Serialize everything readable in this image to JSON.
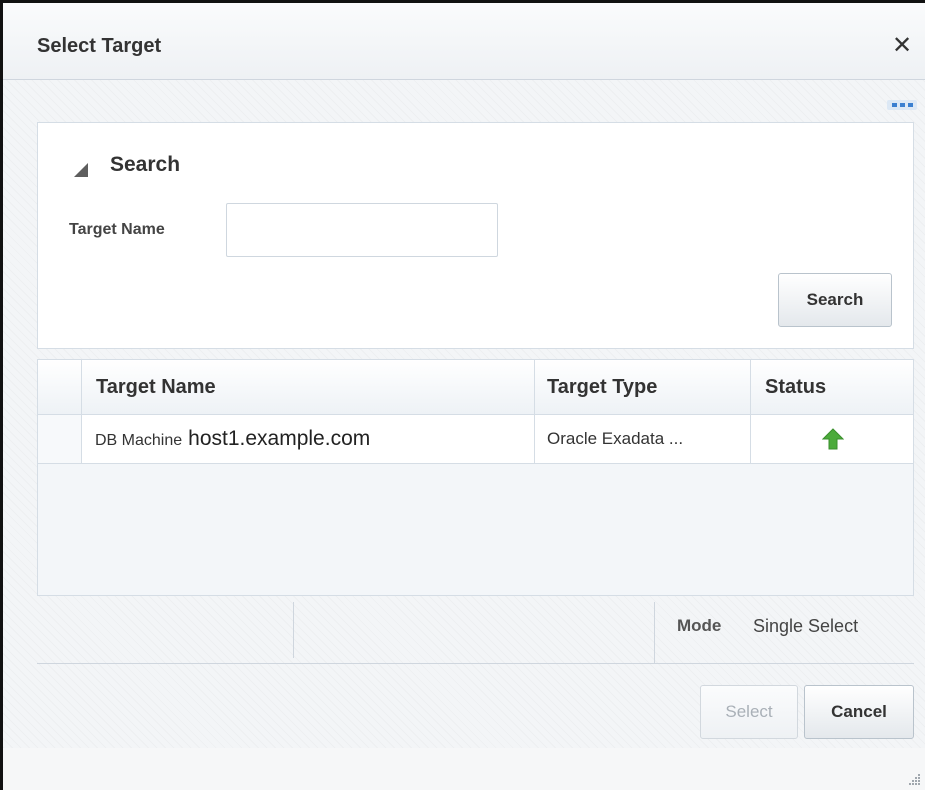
{
  "dialog": {
    "title": "Select Target",
    "close_label": "close"
  },
  "search_panel": {
    "heading": "Search",
    "target_name_label": "Target Name",
    "target_name_value": "",
    "search_button_label": "Search"
  },
  "table": {
    "columns": [
      "Target Name",
      "Target Type",
      "Status"
    ],
    "rows": [
      {
        "name_prefix": "DB Machine",
        "name_host": "host1.example.com",
        "type": "Oracle Exadata ...",
        "status_icon": "up-arrow-icon"
      }
    ]
  },
  "footer": {
    "mode_label": "Mode",
    "mode_value": "Single Select"
  },
  "buttons": {
    "select_label": "Select",
    "cancel_label": "Cancel"
  },
  "colors": {
    "status_up": "#4cab3b",
    "accent": "#3a7fd0"
  }
}
